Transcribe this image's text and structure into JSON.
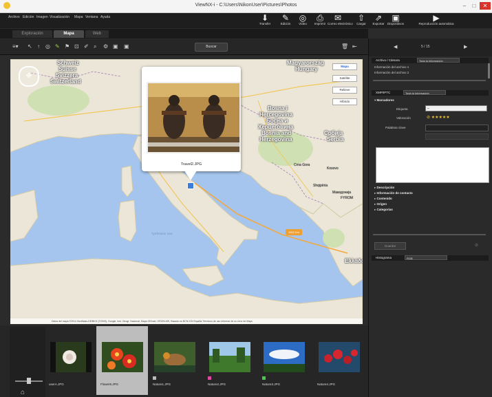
{
  "window": {
    "title": "ViewNX-i - C:\\Users\\NikonUser\\Pictures\\Photos",
    "minimize": "–",
    "maximize": "□",
    "close": "✕"
  },
  "menu": [
    "Archivo",
    "Edición",
    "Imagen",
    "Visualización",
    "Mapa",
    "Ventana",
    "Ayuda"
  ],
  "toolbar": [
    {
      "icon": "transfer-icon",
      "glyph": "⬇",
      "label": "Transfer"
    },
    {
      "icon": "edit-icon",
      "glyph": "✎",
      "label": "Edición"
    },
    {
      "icon": "video-icon",
      "glyph": "◎",
      "label": "Vídeo"
    },
    {
      "icon": "printer-icon",
      "glyph": "⎙",
      "label": "Imprimir"
    },
    {
      "icon": "mail-icon",
      "glyph": "✉",
      "label": "Correo electrónico"
    },
    {
      "icon": "upload-icon",
      "glyph": "⇧",
      "label": "Cargar"
    },
    {
      "icon": "export-icon",
      "glyph": "⇗",
      "label": "Exportar"
    },
    {
      "icon": "devices-icon",
      "glyph": "▣",
      "label": "Dispositivos"
    },
    {
      "icon": "slideshow-icon",
      "glyph": "▶",
      "label": "Reproducción automática"
    }
  ],
  "tabs": [
    "Exploración",
    "Mapa",
    "Web"
  ],
  "active_tab": "Mapa",
  "search_button": "Buscar",
  "map": {
    "labels": {
      "schweiz": "Schweiz",
      "suisse": "Suisse",
      "svizzera": "Svizzera",
      "switzerland": "Switzerland",
      "magyarorszag": "Magyarország",
      "hungary": "Hungary",
      "bosna1": "Bosna i",
      "bosna2": "Hercegovina",
      "bosna3": "Босна и",
      "bosna4": "Херцеговина",
      "bosna5": "Bosnia and",
      "bosna6": "Herzegovina",
      "srbija1": "Србија",
      "srbija2": "Serbia",
      "montenegro": "Crna Gora",
      "kosovo": "Kosovo",
      "albania": "Shqipëria",
      "macedonia1": "Македонија",
      "macedonia2": "FYROM",
      "tyrrhenian": "Tyrrhenian Sea",
      "greece": "Ελλάδα"
    },
    "types": [
      "Mapa",
      "Satélite",
      "Relieve",
      "Híbrido",
      "Relieve"
    ],
    "attribution": "Datos del mapa ©2014 GeoBasis-DE/BKG (©2009), Google, Inst. Geogr. Nacional, Mapa GISrael, ORION-ME, Basado en BCN IGN España   Términos de uso   Informar de un error de Maps",
    "popup_caption": "Travel2.JPG",
    "route_label": "1912 Km"
  },
  "thumbnails": [
    {
      "name": "userA.JPG",
      "label_color": "",
      "selected": false
    },
    {
      "name": "Flower5.JPG",
      "label_color": "",
      "selected": true
    },
    {
      "name": "Nature1.JPG",
      "label_color": "#bbbbbb",
      "selected": false
    },
    {
      "name": "Nature2.JPG",
      "label_color": "#e04aa0",
      "selected": false
    },
    {
      "name": "Nature3.JPG",
      "label_color": "#4ac84a",
      "selected": false
    },
    {
      "name": "Nature4.JPG",
      "label_color": "",
      "selected": false
    }
  ],
  "right_panel": {
    "pager": "5 / 15",
    "file_section": "Archivo / Cámara",
    "file_select": "Toda la información",
    "file_rows": [
      "Información del archivo 1",
      "Información del archivo 2"
    ],
    "xmp_section": "XMP/IPTC",
    "xmp_select": "Toda la información",
    "marcadores": "Marcadores",
    "etiqueta": "Etiqueta",
    "valoracion": "Valoración",
    "palabras_clave": "Palabras clave",
    "collapsed": [
      "Descripción",
      "Información de contacto",
      "Contenido",
      "Origen",
      "Categorías"
    ],
    "apply_button": "Guardar",
    "histogram": "Histograma",
    "histogram_select": "RGB"
  }
}
